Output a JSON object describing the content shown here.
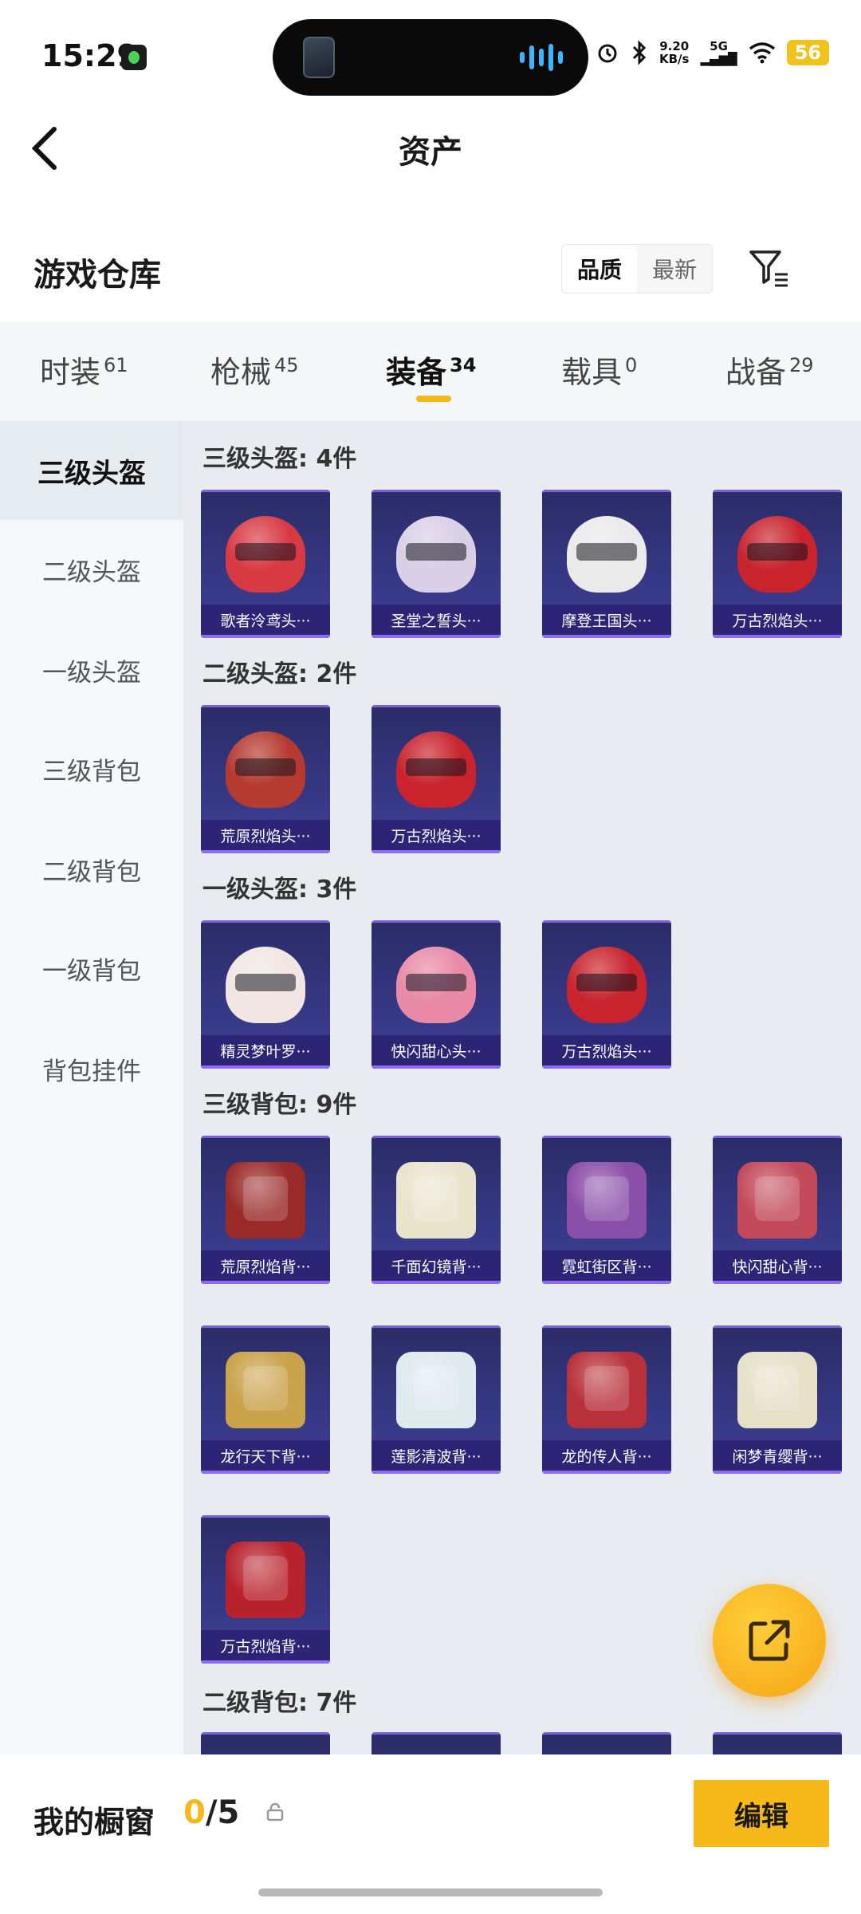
{
  "status": {
    "time": "15:29",
    "net_speed": "9.20",
    "net_unit": "KB/s",
    "network": "5G",
    "battery": "56"
  },
  "header": {
    "title": "资产"
  },
  "warehouse": {
    "title": "游戏仓库",
    "sort_options": [
      "品质",
      "最新"
    ],
    "sort_selected": "品质"
  },
  "tabs": [
    {
      "label": "时装",
      "count": "61"
    },
    {
      "label": "枪械",
      "count": "45"
    },
    {
      "label": "装备",
      "count": "34",
      "active": true
    },
    {
      "label": "载具",
      "count": "0"
    },
    {
      "label": "战备",
      "count": "29"
    }
  ],
  "sidebar": {
    "items": [
      "三级头盔",
      "二级头盔",
      "一级头盔",
      "三级背包",
      "二级背包",
      "一级背包",
      "背包挂件"
    ],
    "active": "三级头盔"
  },
  "groups": [
    {
      "title": "三级头盔: 4件",
      "items": [
        "歌者泠鸢头···",
        "圣堂之誓头···",
        "摩登王国头···",
        "万古烈焰头···"
      ],
      "colors": [
        "#d83a44",
        "#d9cfe6",
        "#eaeaea",
        "#c9242e"
      ]
    },
    {
      "title": "二级头盔: 2件",
      "items": [
        "荒原烈焰头···",
        "万古烈焰头···"
      ],
      "colors": [
        "#b53a30",
        "#c9242e"
      ]
    },
    {
      "title": "一级头盔: 3件",
      "items": [
        "精灵梦叶罗···",
        "快闪甜心头···",
        "万古烈焰头···"
      ],
      "colors": [
        "#f1e6e4",
        "#e88aa8",
        "#c9242e"
      ]
    },
    {
      "title": "三级背包: 9件",
      "items": [
        "荒原烈焰背···",
        "千面幻镜背···",
        "霓虹街区背···",
        "快闪甜心背···",
        "龙行天下背···",
        "莲影清波背···",
        "龙的传人背···",
        "闲梦青缨背···",
        "万古烈焰背···"
      ],
      "colors": [
        "#9a2a2a",
        "#e8e4cc",
        "#8a4fa8",
        "#c24a5a",
        "#c9a24a",
        "#dfe9ee",
        "#b8303a",
        "#e6e0c8",
        "#b8222c"
      ]
    },
    {
      "title": "二级背包: 7件",
      "items": [
        "",
        "",
        "",
        ""
      ],
      "colors": [
        "#5b4fae",
        "#5b4fae",
        "#5b4fae",
        "#5b4fae"
      ]
    }
  ],
  "showcase": {
    "title": "我的橱窗",
    "current": "0",
    "total": "/5",
    "edit_label": "编辑"
  }
}
